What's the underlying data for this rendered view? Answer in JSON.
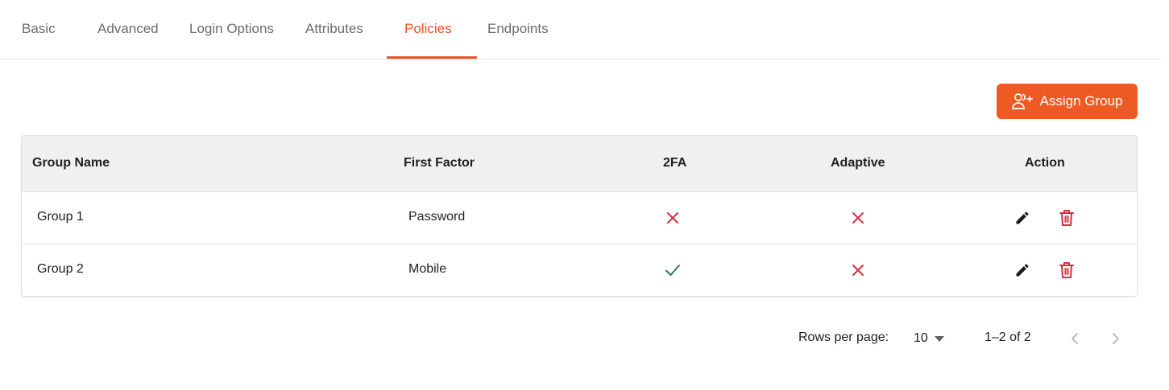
{
  "tabs": [
    {
      "label": "Basic"
    },
    {
      "label": "Advanced"
    },
    {
      "label": "Login Options"
    },
    {
      "label": "Attributes"
    },
    {
      "label": "Policies",
      "active": true
    },
    {
      "label": "Endpoints"
    }
  ],
  "assign_button": {
    "label": "Assign Group",
    "icon": "user-plus-icon",
    "color": "#ee5a24"
  },
  "table": {
    "columns": [
      "Group Name",
      "First Factor",
      "2FA",
      "Adaptive",
      "Action"
    ],
    "rows": [
      {
        "group_name": "Group 1",
        "first_factor": "Password",
        "twofa": "cross",
        "adaptive": "cross"
      },
      {
        "group_name": "Group 2",
        "first_factor": "Mobile",
        "twofa": "check",
        "adaptive": "cross"
      }
    ],
    "action_icons": [
      "pencil-icon",
      "trash-icon"
    ]
  },
  "pagination": {
    "rows_per_page_label": "Rows per page:",
    "rows_per_page_value": "10",
    "range": "1–2 of 2"
  },
  "colors": {
    "accent": "#e8542a",
    "danger": "#d32f3f",
    "success": "#2e7d4f"
  }
}
